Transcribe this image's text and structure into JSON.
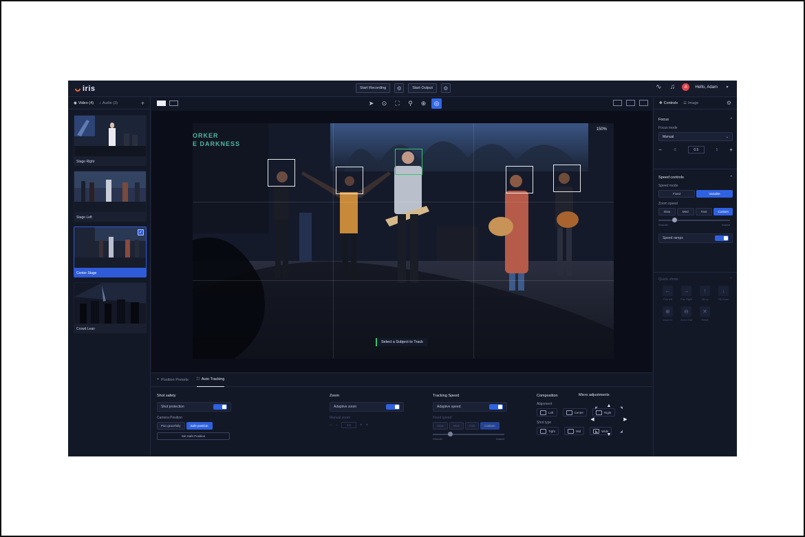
{
  "app": {
    "logo": "iris"
  },
  "header": {
    "start_recording": "Start Recording",
    "start_output": "Start Output",
    "user_initial": "A",
    "user_name": "Helfo, Adam"
  },
  "sources": {
    "tab_video": "Video (4)",
    "tab_audio": "Audio (3)",
    "cameras": [
      {
        "label": "Stage Right"
      },
      {
        "label": "Stage Left"
      },
      {
        "label": "Center Stage"
      },
      {
        "label": "Crowd Lean"
      }
    ]
  },
  "stage": {
    "zoom": "150%",
    "banner_line1": "ORKER",
    "banner_line2": "E DARKNESS",
    "hint": "Select a Subject to Track"
  },
  "bottom": {
    "tab_presets": "Position Presets",
    "tab_tracking": "Auto Tracking",
    "shot_safety": {
      "title": "Shot safety",
      "toggle_label": "Shot protection",
      "camera_position_label": "Camera Position",
      "options": [
        "Pan gracefully",
        "Safe position"
      ],
      "selected": "Safe position",
      "set_button": "Set Safe Position"
    },
    "zoom": {
      "title": "Zoom",
      "toggle_label": "Adaptive zoom",
      "manual_label": "Manual zoom",
      "value": "0.5"
    },
    "tracking_speed": {
      "title": "Tracking Speed",
      "toggle_label": "Adaptive speed",
      "fixed_label": "Fixed speed",
      "options": [
        "Slow",
        "Med",
        "Fast",
        "Custom"
      ],
      "selected": "Custom",
      "min_label": "Smooth",
      "max_label": "Instant"
    },
    "composition": {
      "title": "Composition",
      "alignment_label": "Alignment",
      "alignment": [
        "Left",
        "Center",
        "Right"
      ],
      "shot_type_label": "Shot type",
      "shot_type": [
        "Tight",
        "Mid",
        "Wide"
      ]
    },
    "micro": {
      "title": "Micro adjustments"
    }
  },
  "right": {
    "tab_controls": "Controls",
    "tab_image": "Image",
    "focus": {
      "title": "Focus",
      "mode_label": "Focus mode",
      "mode_value": "Manual",
      "step_small": "-5",
      "value": "0.5",
      "step_small_plus": "5"
    },
    "speed": {
      "title": "Speed controls",
      "mode_label": "Speed mode",
      "mode_options": [
        "Fixed",
        "Variable"
      ],
      "mode_selected": "Variable",
      "zoom_label": "Zoom speed",
      "zoom_options": [
        "Slow",
        "Med",
        "Fast",
        "Custom"
      ],
      "zoom_selected": "Custom",
      "min_label": "Smooth",
      "max_label": "Instant",
      "ramps_label": "Speed ramps"
    },
    "quick_shots": {
      "title": "Quick shots",
      "items": [
        "Pan left",
        "Pan Right",
        "Tilt up",
        "Tilt Down",
        "Zoom in",
        "Zoom Out",
        "Reset"
      ]
    }
  },
  "colors": {
    "accent": "#2f62e0",
    "tracking_green": "#35c46b",
    "background": "#121726"
  }
}
